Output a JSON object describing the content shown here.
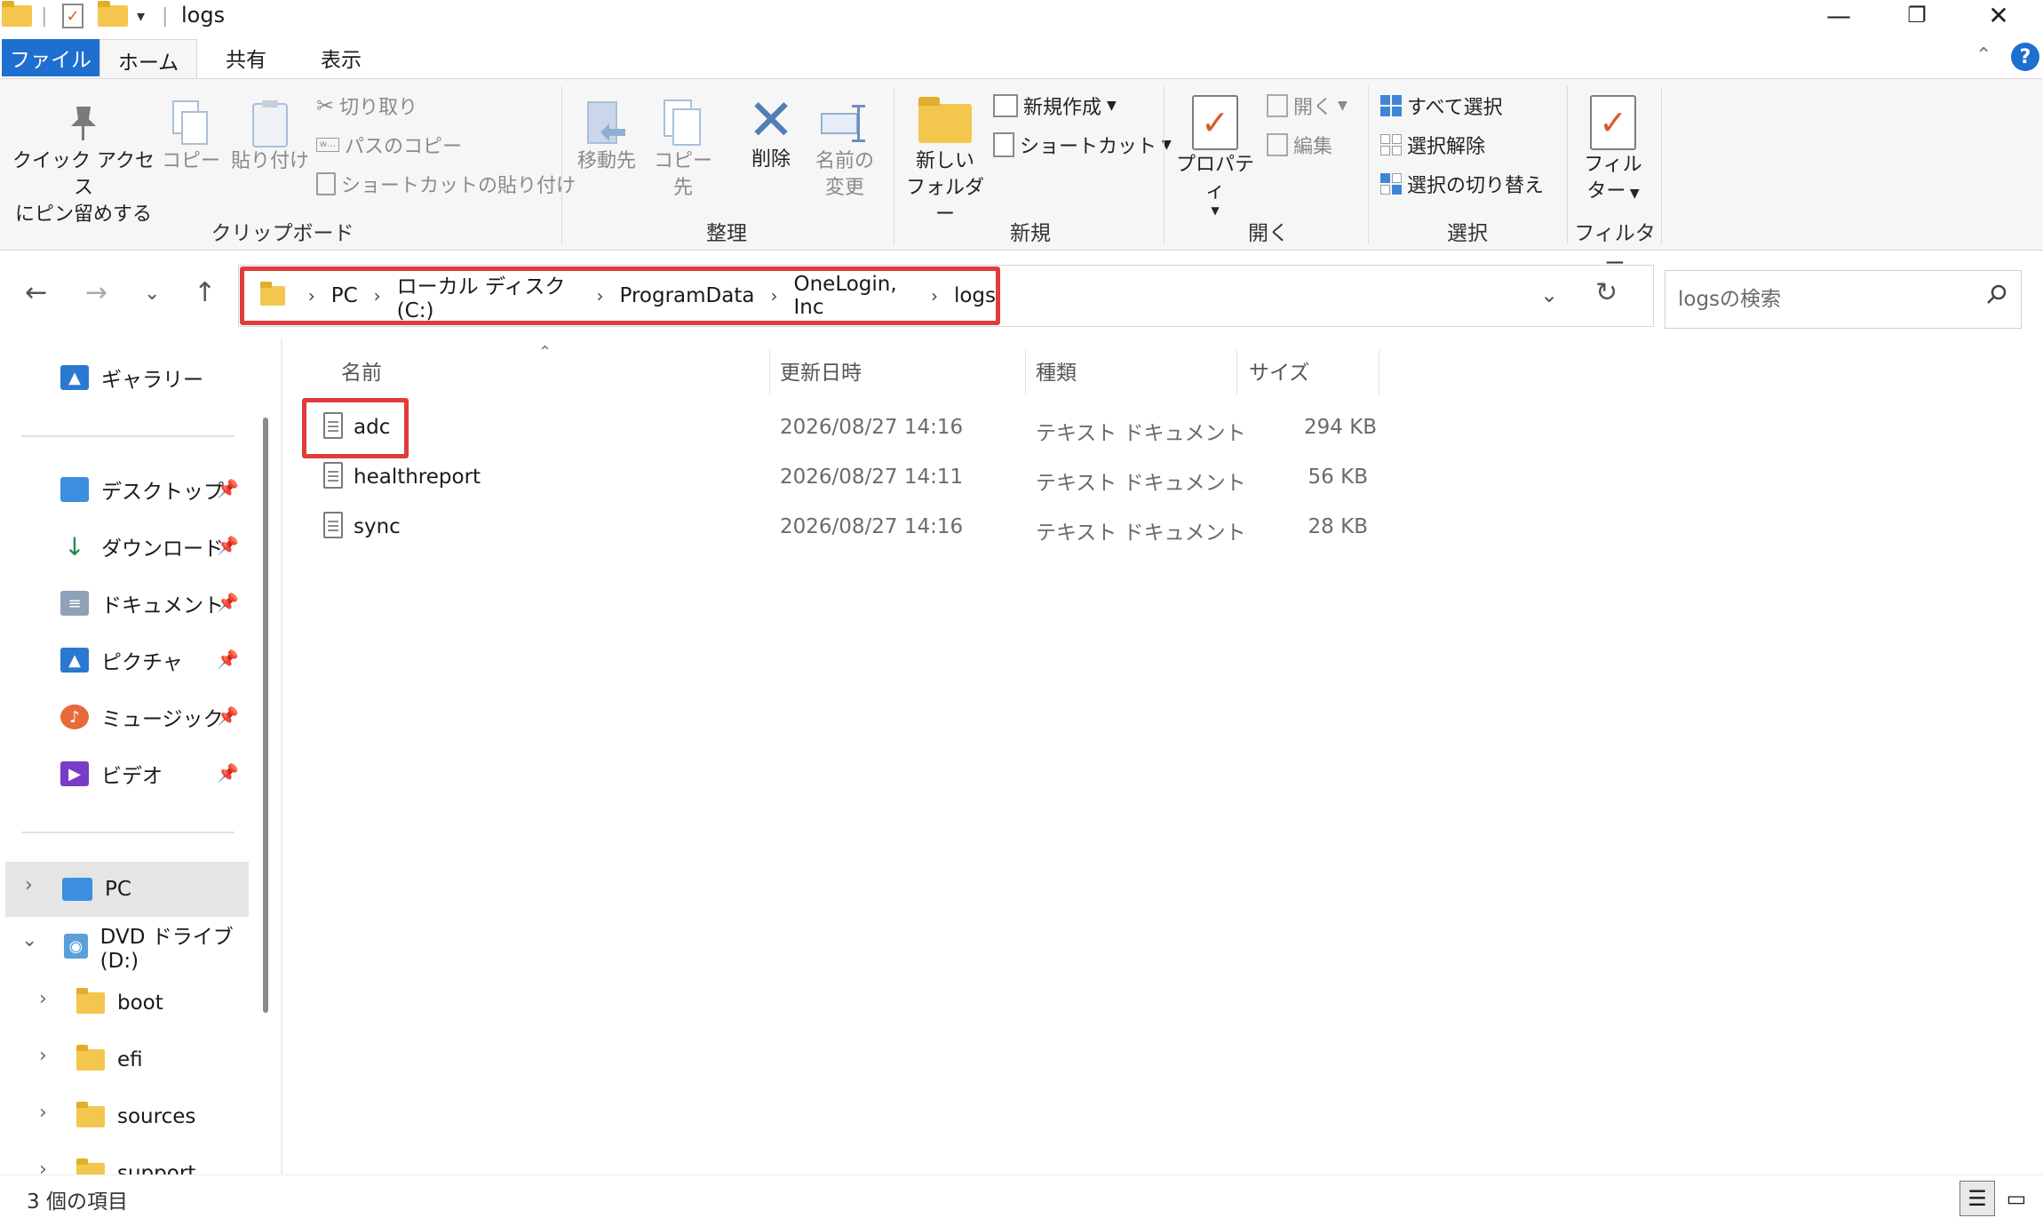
{
  "window": {
    "title": "logs",
    "controls": {
      "minimize": "—",
      "restore": "❐",
      "close": "✕"
    }
  },
  "ribbon_tabs": [
    {
      "label": "ファイル"
    },
    {
      "label": "ホーム"
    },
    {
      "label": "共有"
    },
    {
      "label": "表示"
    }
  ],
  "ribbon": {
    "clipboard": {
      "pin_line1": "クイック アクセス",
      "pin_line2": "にピン留めする",
      "copy": "コピー",
      "paste": "貼り付け",
      "cut": "切り取り",
      "copy_path": "パスのコピー",
      "paste_shortcut": "ショートカットの貼り付け",
      "group": "クリップボード"
    },
    "organize": {
      "move_to": "移動先",
      "copy_to": "コピー先",
      "delete": "削除",
      "rename_line1": "名前の",
      "rename_line2": "変更",
      "group": "整理"
    },
    "new": {
      "new_folder_line1": "新しい",
      "new_folder_line2": "フォルダー",
      "new_item": "新規作成",
      "shortcut": "ショートカット",
      "group": "新規"
    },
    "open": {
      "properties": "プロパティ",
      "open": "開く",
      "edit": "編集",
      "group": "開く"
    },
    "select": {
      "select_all": "すべて選択",
      "select_none": "選択解除",
      "invert": "選択の切り替え",
      "group": "選択"
    },
    "filter": {
      "filter_line1": "フィル",
      "filter_line2": "ター",
      "group": "フィルター"
    }
  },
  "address": {
    "crumbs": [
      "PC",
      "ローカル ディスク (C:)",
      "ProgramData",
      "OneLogin, Inc",
      "logs"
    ],
    "search_placeholder": "logsの検索"
  },
  "nav": {
    "gallery": "ギャラリー",
    "quick_access": [
      "デスクトップ",
      "ダウンロード",
      "ドキュメント",
      "ピクチャ",
      "ミュージック",
      "ビデオ"
    ],
    "pc": "PC",
    "dvd": "DVD ドライブ (D:)",
    "dvd_children": [
      "boot",
      "efi",
      "sources",
      "support"
    ]
  },
  "columns": {
    "name": "名前",
    "modified": "更新日時",
    "type": "種類",
    "size": "サイズ"
  },
  "files": [
    {
      "name": "adc",
      "modified": "2026/08/27 14:16",
      "type": "テキスト ドキュメント",
      "size": "294 KB"
    },
    {
      "name": "healthreport",
      "modified": "2026/08/27 14:11",
      "type": "テキスト ドキュメント",
      "size": "56 KB"
    },
    {
      "name": "sync",
      "modified": "2026/08/27 14:16",
      "type": "テキスト ドキュメント",
      "size": "28 KB"
    }
  ],
  "status": {
    "item_count": "3 個の項目"
  },
  "colors": {
    "accent": "#1e6fcf",
    "highlight": "#e13c3c",
    "folder": "#f3c64e"
  }
}
